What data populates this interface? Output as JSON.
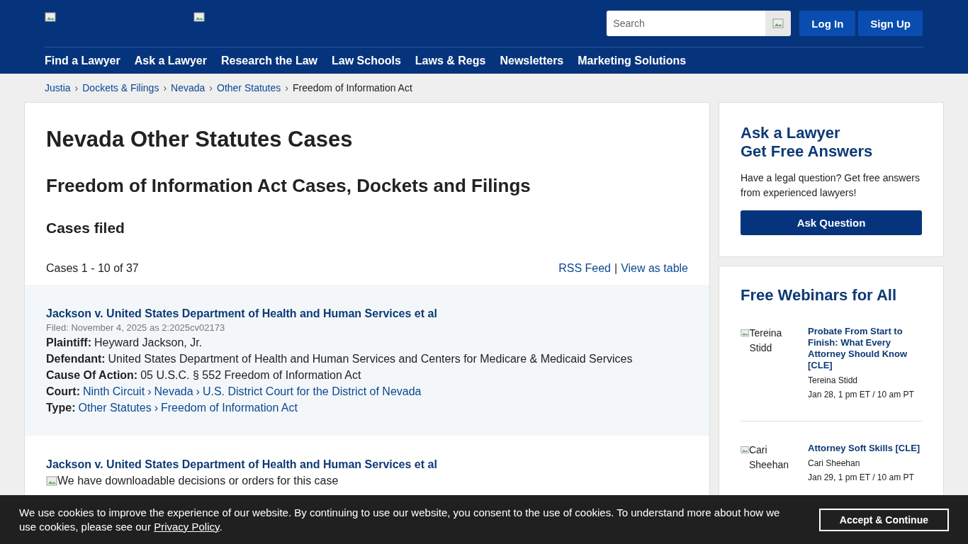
{
  "header": {
    "search": {
      "placeholder": "Search"
    },
    "buttons": [
      "Log In",
      "Sign Up"
    ],
    "nav": [
      "Find a Lawyer",
      "Ask a Lawyer",
      "Research the Law",
      "Law Schools",
      "Laws & Regs",
      "Newsletters",
      "Marketing Solutions"
    ]
  },
  "breadcrumb": [
    {
      "kind": "link",
      "text": "Justia"
    },
    {
      "kind": "sep",
      "text": "›"
    },
    {
      "kind": "link",
      "text": "Dockets & Filings"
    },
    {
      "kind": "sep",
      "text": "›"
    },
    {
      "kind": "link",
      "text": "Nevada"
    },
    {
      "kind": "sep",
      "text": "›"
    },
    {
      "kind": "link",
      "text": "Other Statutes"
    },
    {
      "kind": "sep",
      "text": "›"
    },
    {
      "kind": "current",
      "text": "Freedom of Information Act"
    }
  ],
  "main": {
    "title": "Nevada Other Statutes Cases",
    "subtitle": "Freedom of Information Act Cases, Dockets and Filings",
    "section": "Cases filed",
    "count": "Cases 1 - 10 of 37",
    "links": [
      {
        "kind": "link",
        "text": "RSS Feed"
      },
      {
        "kind": "sep",
        "text": "|"
      },
      {
        "kind": "link",
        "text": "View as table"
      }
    ],
    "cases": [
      {
        "title": "Jackson v. United States Department of Health and Human Services et al",
        "filed": "Filed: November 4, 2025 as 2:2025cv02173",
        "fields": [
          {
            "label": "Plaintiff:",
            "parts": [
              {
                "kind": "text",
                "text": "Heyward Jackson, Jr."
              }
            ]
          },
          {
            "label": "Defendant:",
            "parts": [
              {
                "kind": "text",
                "text": "United States Department of Health and Human Services and Centers for Medicare & Medicaid Services"
              }
            ]
          },
          {
            "label": "Cause Of Action:",
            "parts": [
              {
                "kind": "text",
                "text": "05 U.S.C. § 552 Freedom of Information Act"
              }
            ]
          },
          {
            "label": "Court:",
            "parts": [
              {
                "kind": "link",
                "text": "Ninth Circuit"
              },
              {
                "kind": "sep",
                "text": "›"
              },
              {
                "kind": "link",
                "text": "Nevada"
              },
              {
                "kind": "sep",
                "text": "›"
              },
              {
                "kind": "link",
                "text": "U.S. District Court for the District of Nevada"
              }
            ]
          },
          {
            "label": "Type:",
            "parts": [
              {
                "kind": "link",
                "text": "Other Statutes"
              },
              {
                "kind": "sep",
                "text": "›"
              },
              {
                "kind": "link",
                "text": "Freedom of Information Act"
              }
            ]
          }
        ]
      },
      {
        "title": "Jackson v. United States Department of Health and Human Services et al",
        "image_alt": "We have downloadable decisions or orders for this case"
      }
    ]
  },
  "sidebar": {
    "ask": {
      "title": [
        "Ask a Lawyer",
        "Get Free Answers"
      ],
      "text": "Have a legal question? Get free answers from experienced lawyers!",
      "button": "Ask Question"
    },
    "webinars": {
      "title": "Free Webinars for All",
      "items": [
        {
          "photo_alt": "Tereina Stidd",
          "title": "Probate From Start to Finish: What Every Attorney Should Know [CLE]",
          "presenter": "Tereina Stidd",
          "time": "Jan 28, 1 pm ET / 10 am PT"
        },
        {
          "photo_alt": "Cari Sheehan",
          "title": "Attorney Soft Skills [CLE]",
          "presenter": "Cari Sheehan",
          "time": "Jan 29, 1 pm ET / 10 am PT"
        }
      ]
    }
  },
  "cookie": {
    "text": "We use cookies to improve the experience of our website. By continuing to use our website, you consent to the use of cookies. To understand more about how we use cookies, please see our ",
    "link": "Privacy Policy",
    "after": ".",
    "button": "Accept & Continue"
  }
}
